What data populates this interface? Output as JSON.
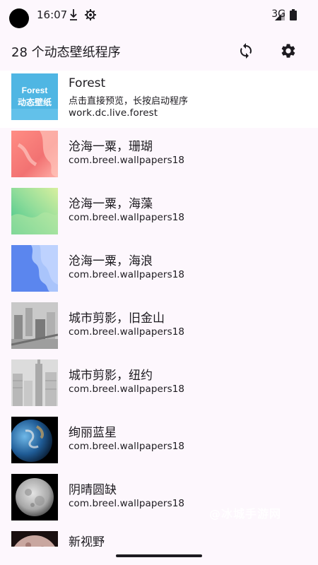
{
  "status_bar": {
    "time": "16:07",
    "network": "3G",
    "icons": [
      "download-icon",
      "settings-status-icon",
      "signal-icon",
      "battery-icon"
    ]
  },
  "app_bar": {
    "title": "28 个动态壁纸程序",
    "actions": [
      "refresh-icon",
      "settings-icon"
    ]
  },
  "wallpapers": [
    {
      "name": "Forest",
      "description": "点击直接预览，长按启动程序",
      "package": "work.dc.live.forest",
      "thumb_text_1": "Forest",
      "thumb_text_2": "动态壁纸"
    },
    {
      "name": "沧海一粟，珊瑚",
      "package": "com.breel.wallpapers18"
    },
    {
      "name": "沧海一粟，海藻",
      "package": "com.breel.wallpapers18"
    },
    {
      "name": "沧海一粟，海浪",
      "package": "com.breel.wallpapers18"
    },
    {
      "name": "城市剪影，旧金山",
      "package": "com.breel.wallpapers18"
    },
    {
      "name": "城市剪影，纽约",
      "package": "com.breel.wallpapers18"
    },
    {
      "name": "绚丽蓝星",
      "package": "com.breel.wallpapers18"
    },
    {
      "name": "阴晴圆缺",
      "package": "com.breel.wallpapers18"
    },
    {
      "name": "新视野",
      "package": ""
    }
  ],
  "watermark": "@冰城手游网",
  "colors": {
    "background": "#fdf7fd",
    "forest_thumb": "#4fb6e3",
    "coral_thumb": "#f27e7e",
    "seaweed_thumb": "#7fd3a0",
    "wave_thumb": "#6f97f2"
  }
}
